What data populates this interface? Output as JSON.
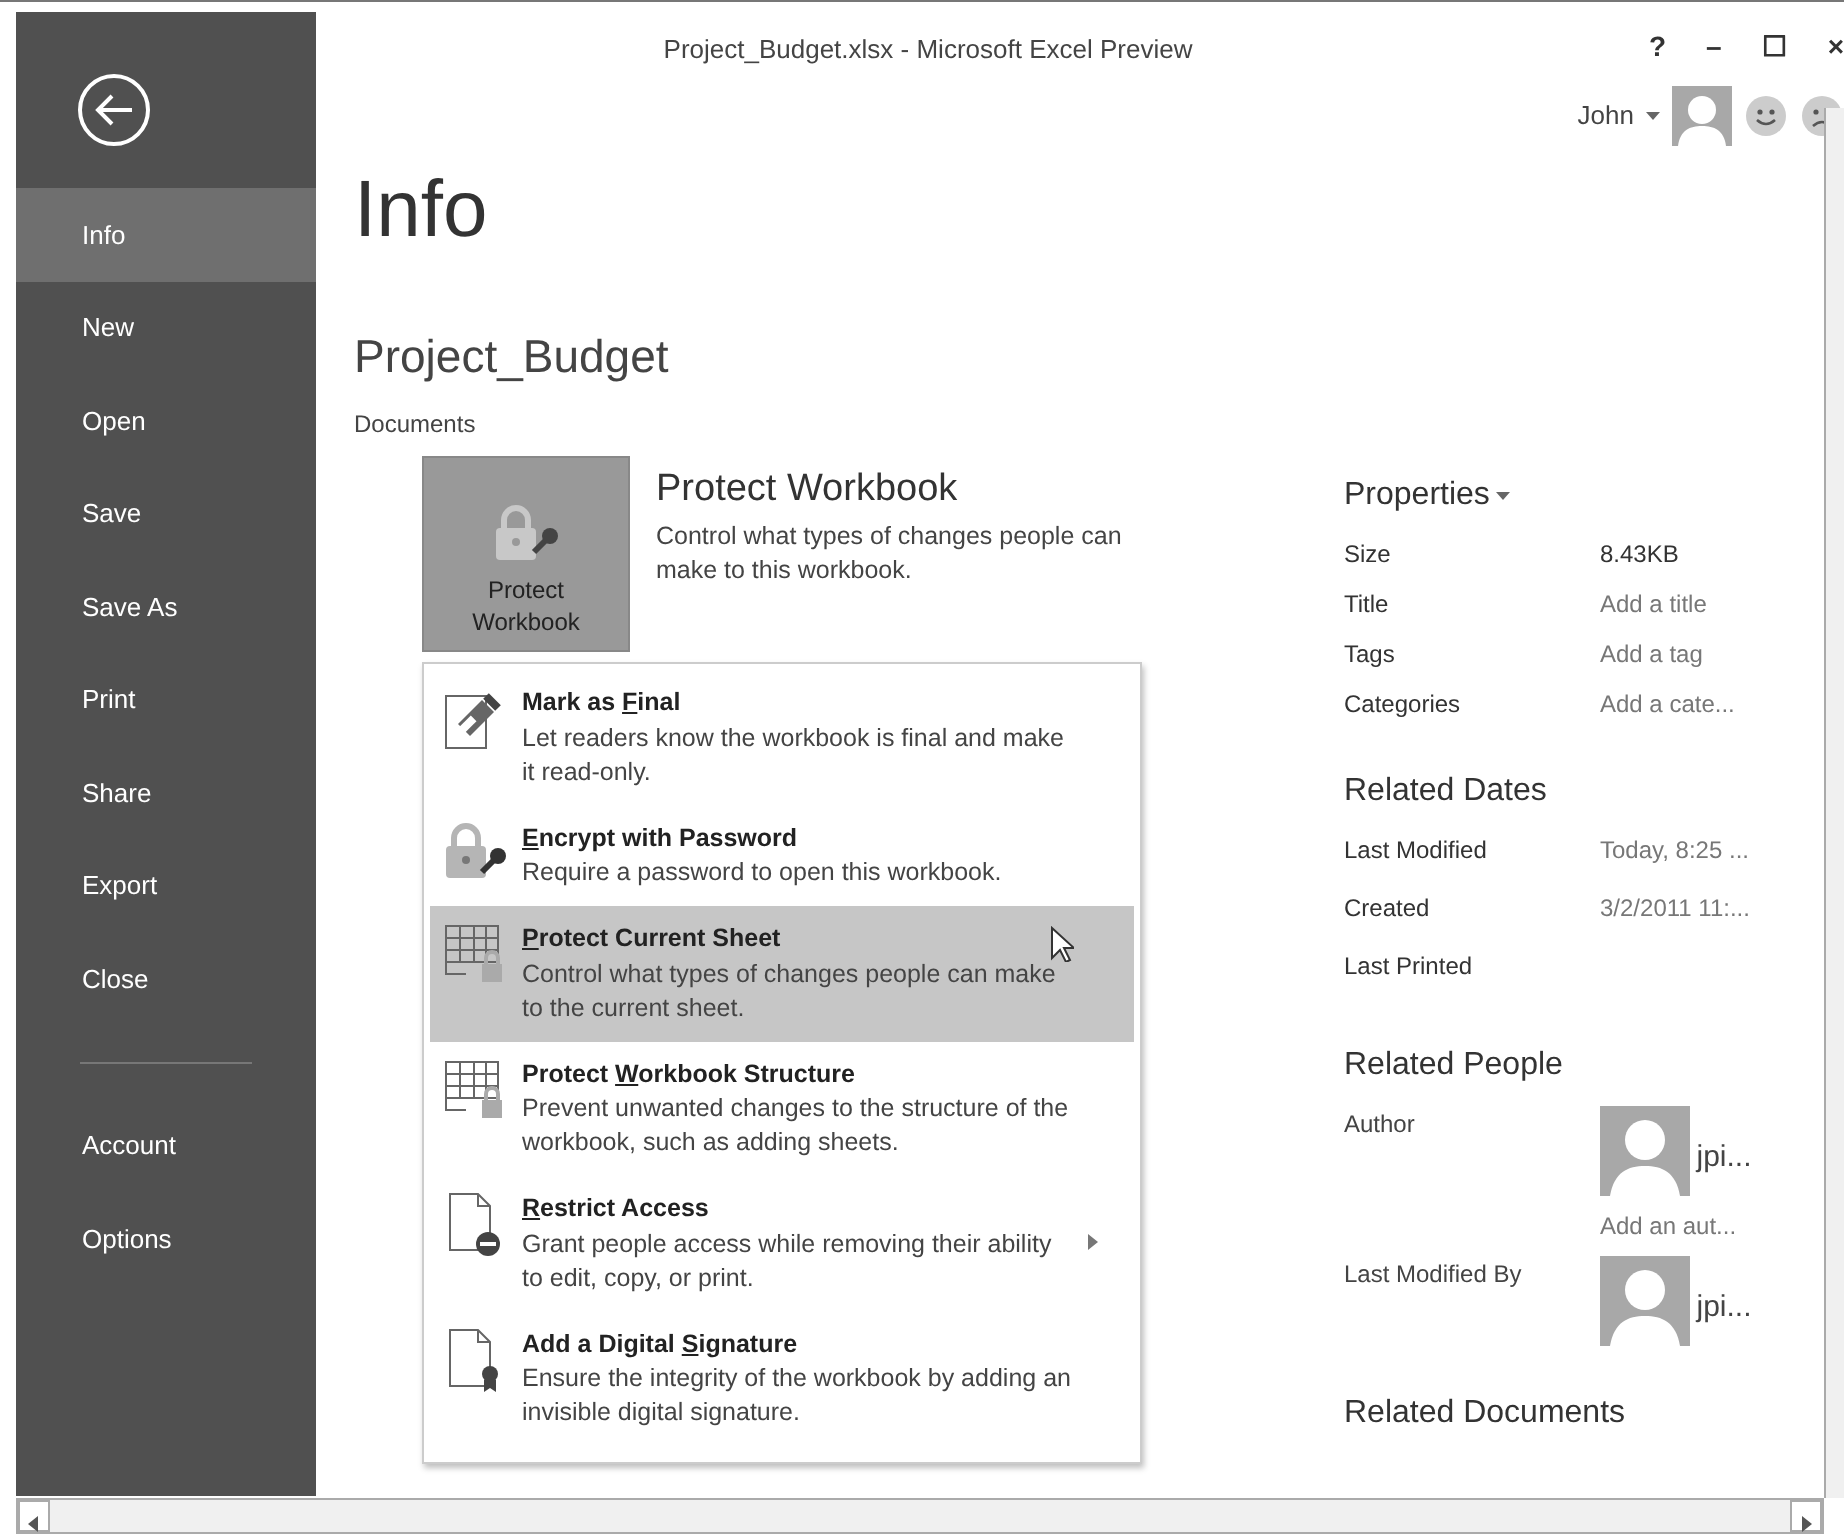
{
  "window": {
    "title": "Project_Budget.xlsx - Microsoft Excel Preview",
    "controls": [
      "?",
      "–",
      "☐",
      "×"
    ]
  },
  "user": {
    "name": "John"
  },
  "sidebar": {
    "items": [
      {
        "label": "Info",
        "selected": true
      },
      {
        "label": "New",
        "selected": false
      },
      {
        "label": "Open",
        "selected": false
      },
      {
        "label": "Save",
        "selected": false
      },
      {
        "label": "Save As",
        "selected": false
      },
      {
        "label": "Print",
        "selected": false
      },
      {
        "label": "Share",
        "selected": false
      },
      {
        "label": "Export",
        "selected": false
      },
      {
        "label": "Close",
        "selected": false
      }
    ],
    "bottom_items": [
      {
        "label": "Account",
        "selected": false
      },
      {
        "label": "Options",
        "selected": false
      }
    ]
  },
  "heading": "Info",
  "document_name": "Project_Budget",
  "location": "Documents",
  "protect": {
    "button_lines": [
      "Protect",
      "Workbook"
    ],
    "title": "Protect Workbook",
    "description": "Control what types of changes people can make to this workbook."
  },
  "menu": [
    {
      "kind": "final",
      "title_parts": {
        "before": "Mark as ",
        "key": "F",
        "after": "inal"
      },
      "description": "Let readers know the workbook is final and make it read-only.",
      "highlighted": false,
      "submenu": false
    },
    {
      "kind": "lock",
      "title_parts": {
        "key": "E",
        "after": "ncrypt with Password"
      },
      "description": "Require a password to open this workbook.",
      "highlighted": false,
      "submenu": false
    },
    {
      "kind": "sheet",
      "title_parts": {
        "key": "P",
        "after": "rotect Current Sheet"
      },
      "description": "Control what types of changes people can make to the current sheet.",
      "highlighted": true,
      "submenu": false
    },
    {
      "kind": "structure",
      "title_parts": {
        "before": "Protect ",
        "key": "W",
        "after": "orkbook Structure"
      },
      "description": "Prevent unwanted changes to the structure of the workbook, such as adding sheets.",
      "highlighted": false,
      "submenu": false
    },
    {
      "kind": "restrict",
      "title_parts": {
        "key": "R",
        "after": "estrict Access"
      },
      "description": "Grant people access while removing their ability to edit, copy, or print.",
      "highlighted": false,
      "submenu": true
    },
    {
      "kind": "signature",
      "title_parts": {
        "before": "Add a Digital ",
        "key": "S",
        "after": "ignature"
      },
      "description": "Ensure the integrity of the workbook by adding an invisible digital signature.",
      "highlighted": false,
      "submenu": false
    }
  ],
  "properties": {
    "title": "Properties",
    "rows": [
      {
        "label": "Size",
        "value": "8.43KB",
        "placeholder": false
      },
      {
        "label": "Title",
        "value": "Add a title",
        "placeholder": true
      },
      {
        "label": "Tags",
        "value": "Add a tag",
        "placeholder": true
      },
      {
        "label": "Categories",
        "value": "Add a cate...",
        "placeholder": true
      }
    ]
  },
  "related_dates": {
    "title": "Related Dates",
    "rows": [
      {
        "label": "Last Modified",
        "value": "Today, 8:25 ..."
      },
      {
        "label": "Created",
        "value": "3/2/2011 11:..."
      },
      {
        "label": "Last Printed"
      }
    ]
  },
  "related_people": {
    "title": "Related People",
    "rows": [
      {
        "label": "Author",
        "person": "jpi...",
        "add": "Add an aut..."
      },
      {
        "label": "Last Modified By",
        "person": "jpi..."
      }
    ]
  },
  "related_documents": {
    "title": "Related Documents"
  }
}
